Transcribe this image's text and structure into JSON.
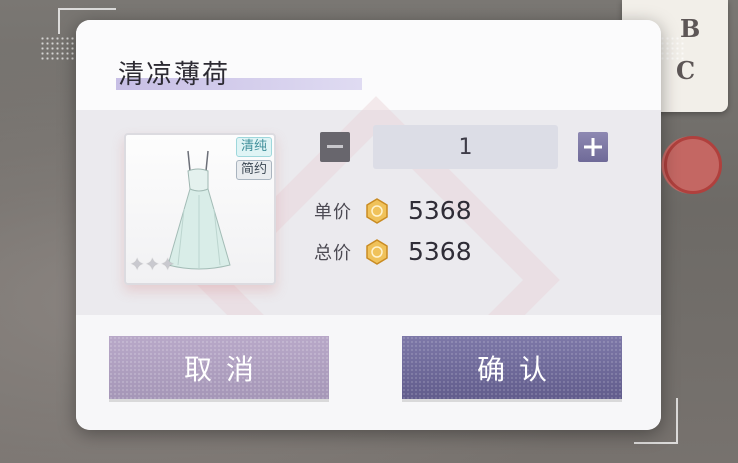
{
  "background": {
    "card_letters": [
      "B",
      "C"
    ]
  },
  "dialog": {
    "title": "清凉薄荷",
    "item": {
      "tags": [
        "清纯",
        "简约"
      ],
      "stars": 3,
      "image": "white-dress-icon"
    },
    "quantity": {
      "value": "1",
      "minus_icon": "minus-icon",
      "plus_icon": "plus-icon"
    },
    "unit_price": {
      "label": "单价",
      "value": "5368",
      "currency_icon": "gold-coin-icon"
    },
    "total_price": {
      "label": "总价",
      "value": "5368",
      "currency_icon": "gold-coin-icon"
    },
    "buttons": {
      "cancel": "取消",
      "confirm": "确认"
    }
  },
  "colors": {
    "cancel_button": "#a596b7",
    "confirm_button": "#615c8c",
    "tag_fresh": "#3f8f9a",
    "tag_simple": "#3e4a56",
    "coin": "#e0a83a"
  }
}
